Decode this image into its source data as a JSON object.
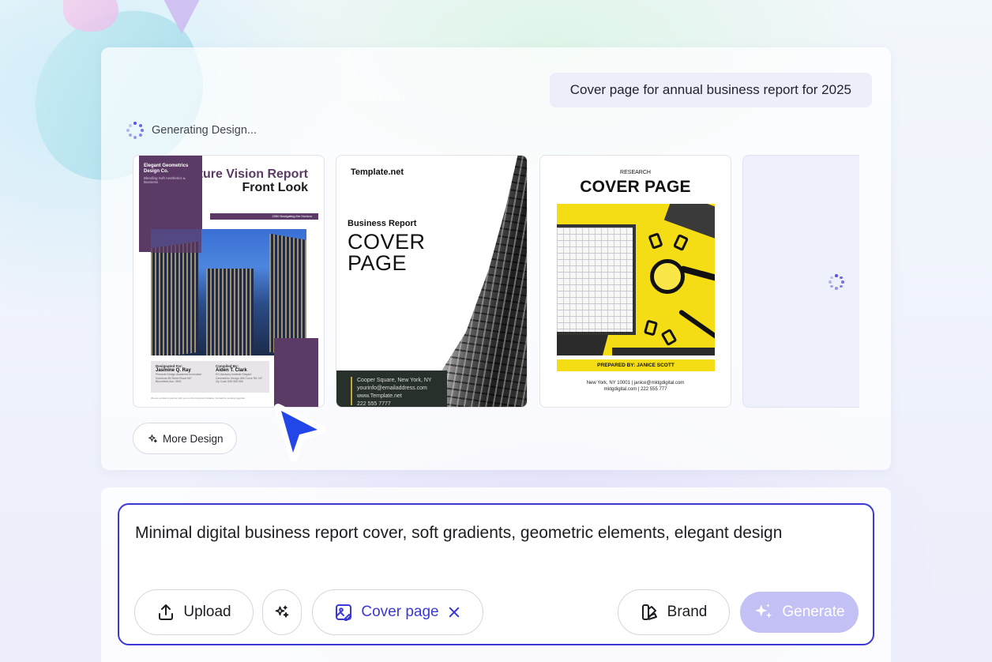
{
  "prompt_chip": "Cover page for annual business report for 2025",
  "status": {
    "text": "Generating Design..."
  },
  "designs": {
    "card1": {
      "company": "Elegant Geometrics Design Co.",
      "tagline": "Blending Soft Aesthetics & Business",
      "title_line1": "Future Vision Report",
      "title_line2": "Front Look",
      "band_text": "2050 Navigating the Horizon",
      "designed_for_label": "Designated For:",
      "designed_for_name": "Jasmine Q. Ray",
      "designed_for_detail": "Pinnacle Design Academic Innovative Solutions 88 Street Road 567 Bloomfield Ave, 0831",
      "compiled_by_label": "Compiled By:",
      "compiled_by_name": "Aiden T. Clark",
      "compiled_by_detail": "EG Advisory Institute Elegant Geometrics Design 456 Curve Rd, NY Zip Code 555 555 555",
      "footer": "We are excited to partner with you on this important initiative. Forward to working together."
    },
    "card2": {
      "brand": "Template.net",
      "subtitle": "Business Report",
      "title_line1": "COVER",
      "title_line2": "PAGE",
      "address": "Cooper Square, New York, NY",
      "email": "yourinfo@emailaddress.com",
      "website": "www.Template.net",
      "phone": "222 555 7777"
    },
    "card3": {
      "kicker": "RESEARCH",
      "title": "COVER PAGE",
      "prepared_by": "PREPARED BY: JANICE SCOTT",
      "contact_line1": "New York, NY 10001  |  janice@mktgdigital.com",
      "contact_line2": "mktgdigital.com  |  222 555 777"
    }
  },
  "more_design": "More Design",
  "composer": {
    "text": "Minimal digital business report cover, soft gradients, geometric elements, elegant design"
  },
  "buttons": {
    "upload": "Upload",
    "cover_page": "Cover page",
    "brand": "Brand",
    "generate": "Generate"
  },
  "icons": {
    "spinner": "loading-spinner-icon",
    "sparkle": "sparkle-icon",
    "upload": "upload-icon",
    "magic": "magic-sparkle-icon",
    "cover": "image-edit-icon",
    "close": "close-icon",
    "brand": "brand-palette-icon",
    "pointer": "cursor-pointer-icon"
  },
  "colors": {
    "accent": "#3a38d6",
    "generate_bg": "#c3c0f6",
    "card1_purple": "#5c3a66",
    "card3_yellow": "#f4dd14"
  }
}
